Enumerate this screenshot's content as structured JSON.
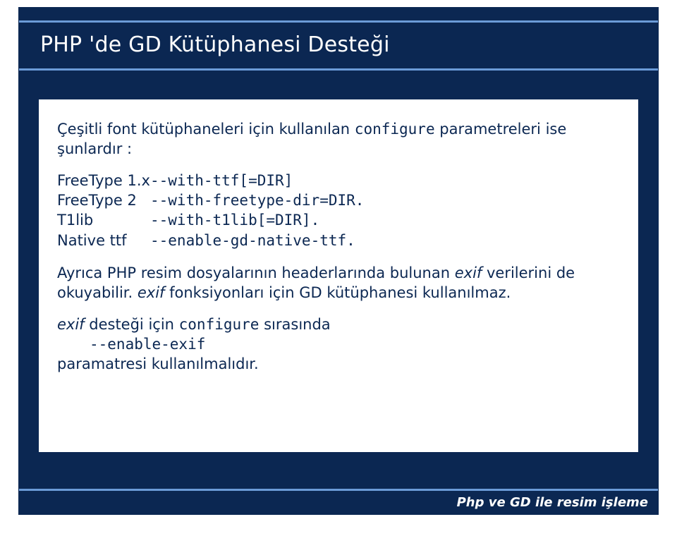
{
  "title": "PHP 'de GD Kütüphanesi Desteği",
  "intro": {
    "pre": "Çeşitli font kütüphaneleri için kullanılan ",
    "code": "configure",
    "post": " parametreleri ise şunlardır :"
  },
  "config": {
    "rows": [
      {
        "label": "FreeType 1.x",
        "value": "--with-ttf[=DIR]"
      },
      {
        "label": "FreeType 2",
        "value": "--with-freetype-dir=DIR."
      },
      {
        "label": "T1lib",
        "value": "--with-t1lib[=DIR]."
      },
      {
        "label": "Native ttf",
        "value": "--enable-gd-native-ttf."
      }
    ]
  },
  "exif1": {
    "a": "Ayrıca PHP resim dosyalarının headerlarında bulunan ",
    "b": "exif",
    "c": " verilerini de okuyabilir. ",
    "d": "exif",
    "e": " fonksiyonları için GD kütüphanesi kullanılmaz."
  },
  "exif2": {
    "a": "exif",
    "b": " desteği için ",
    "c": "configure",
    "d": " sırasında"
  },
  "exif_opt": "--enable-exif",
  "exif_tail": "paramatresi kullanılmalıdır.",
  "footer": "Php ve GD ile resim işleme"
}
